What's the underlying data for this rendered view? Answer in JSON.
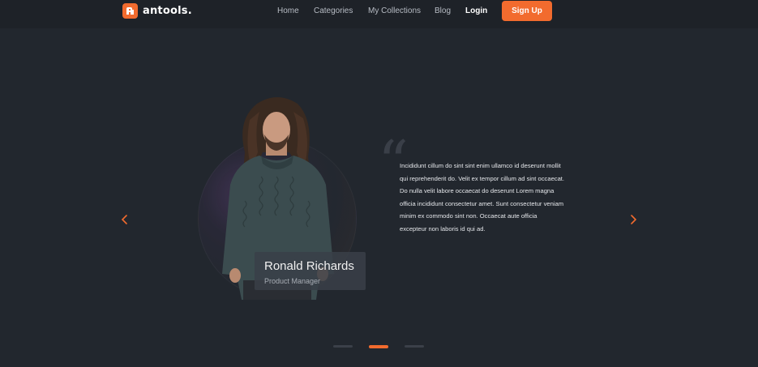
{
  "brand": {
    "name": "antools.",
    "color": "#f26b2e"
  },
  "nav": {
    "links": [
      {
        "label": "Home"
      },
      {
        "label": "Categories"
      },
      {
        "label": "My Collections"
      },
      {
        "label": "Blog"
      },
      {
        "label": "Login"
      }
    ],
    "signup_label": "Sign Up"
  },
  "testimonial": {
    "name": "Ronald Richards",
    "role": "Product Manager",
    "quote_lines": [
      "Incididunt cillum do sint sint enim ullamco id deserunt mollit",
      "qui reprehenderit do. Velit ex tempor cillum ad sint occaecat.",
      "Do nulla velit labore occaecat do deserunt Lorem magna",
      "officia incididunt consectetur amet. Sunt consectetur veniam",
      "minim ex commodo sint non. Occaecat aute officia",
      "excepteur non laboris id qui ad."
    ]
  },
  "carousel": {
    "slide_count": 3,
    "active_index": 1
  },
  "icons": {
    "prev": "chevron-left-icon",
    "next": "chevron-right-icon",
    "quote": "quote-icon",
    "logo": "logo-mark-icon"
  }
}
